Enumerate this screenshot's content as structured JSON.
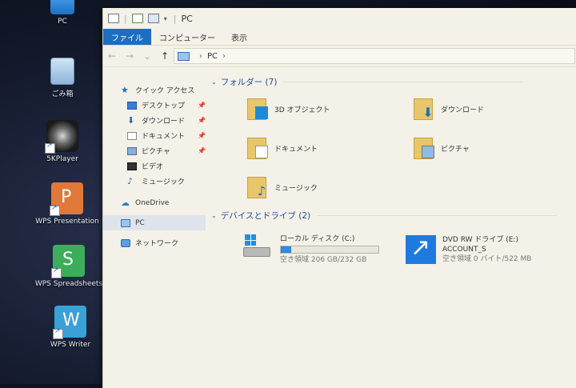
{
  "desktop": {
    "icons": [
      {
        "label": "PC",
        "icon": "pc-icon"
      },
      {
        "label": "ごみ箱",
        "icon": "recycle-bin-icon"
      },
      {
        "label": "5KPlayer",
        "icon": "5kplayer-icon"
      },
      {
        "label": "WPS Presentation",
        "icon": "wps-presentation-icon",
        "color": "#e0783a"
      },
      {
        "label": "WPS Spreadsheets",
        "icon": "wps-spreadsheets-icon",
        "color": "#3cae5b"
      },
      {
        "label": "WPS Writer",
        "icon": "wps-writer-icon",
        "color": "#3aa0d8"
      }
    ]
  },
  "window": {
    "title": "PC",
    "ribbon_tabs": [
      "ファイル",
      "コンピューター",
      "表示"
    ],
    "active_tab": "ファイル",
    "address": {
      "crumbs": [
        "PC"
      ]
    },
    "nav": {
      "quick_access": "クイック アクセス",
      "items": [
        {
          "label": "デスクトップ",
          "icon": "desktop-icon",
          "pinned": true
        },
        {
          "label": "ダウンロード",
          "icon": "download-icon",
          "pinned": true
        },
        {
          "label": "ドキュメント",
          "icon": "documents-icon",
          "pinned": true
        },
        {
          "label": "ピクチャ",
          "icon": "pictures-icon",
          "pinned": true
        },
        {
          "label": "ビデオ",
          "icon": "videos-icon",
          "pinned": false
        },
        {
          "label": "ミュージック",
          "icon": "music-icon",
          "pinned": false
        }
      ],
      "onedrive": "OneDrive",
      "pc": "PC",
      "network": "ネットワーク"
    },
    "folders": {
      "heading": "フォルダー (7)",
      "items": [
        {
          "label": "3D オブジェクト",
          "icon": "3d-objects-icon"
        },
        {
          "label": "ダウンロード",
          "icon": "downloads-folder-icon"
        },
        {
          "label": "ドキュメント",
          "icon": "documents-folder-icon"
        },
        {
          "label": "ピクチャ",
          "icon": "pictures-folder-icon"
        },
        {
          "label": "ミュージック",
          "icon": "music-folder-icon"
        }
      ]
    },
    "drives": {
      "heading": "デバイスとドライブ (2)",
      "local": {
        "label": "ローカル ディスク (C:)",
        "free": "空き領域 206 GB/232 GB",
        "used_fraction": 0.11
      },
      "dvd": {
        "label": "DVD RW ドライブ (E:)",
        "volume": "ACCOUNT_S",
        "free": "空き領域 0 バイト/522 MB"
      }
    }
  },
  "colors": {
    "accent": "#1d6ec2",
    "folder": "#e8c66a",
    "drive_fill": "#2c8be6"
  }
}
